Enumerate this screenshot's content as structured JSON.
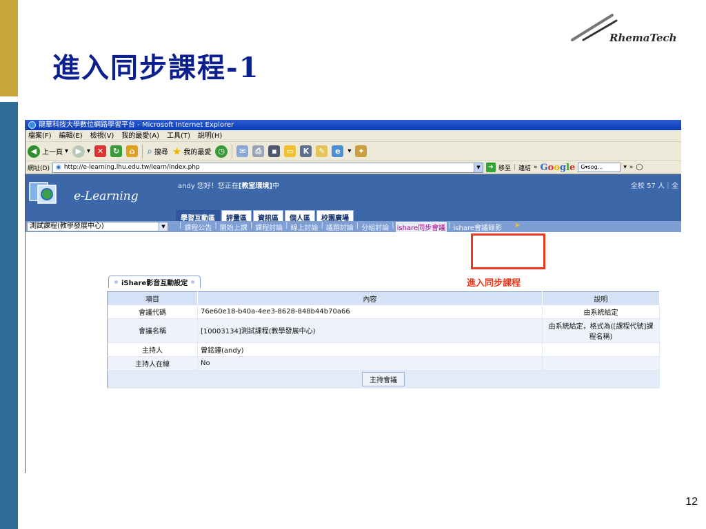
{
  "slide": {
    "title": "進入同步課程-1",
    "logo_text": "RhemaTech",
    "page_number": "12"
  },
  "browser": {
    "window_title": "龍華科技大學數位網路學習平台 - Microsoft Internet Explorer",
    "menu": [
      "檔案(F)",
      "編輯(E)",
      "檢視(V)",
      "我的最愛(A)",
      "工具(T)",
      "說明(H)"
    ],
    "toolbar": {
      "back_label": "上一頁",
      "search_label": "搜尋",
      "favorites_label": "我的最愛"
    },
    "address": {
      "label": "網址(D)",
      "url": "http://e-learning.lhu.edu.tw/learn/index.php",
      "go_label": "移至",
      "links_label": "連結",
      "google": "Google",
      "google_input": "G▾sog..."
    }
  },
  "site": {
    "name": "e-Learning",
    "greeting_user": "andy",
    "greeting_prefix": "您好！您正在",
    "greeting_place": "[教室環境]",
    "greeting_suffix": "中",
    "online_count": "全校 57 人｜全",
    "tabs": [
      "學習互動區",
      "評量區",
      "資訊區",
      "個人區",
      "校園廣場"
    ],
    "course_select": "測試課程(教學發展中心)",
    "nav_links": [
      "課程公告",
      "開始上課",
      "課程討論",
      "線上討論",
      "議題討論",
      "分組討論"
    ],
    "nav_highlight": "ishare同步會議",
    "nav_record": "ishare會議錄影"
  },
  "callout": {
    "label": "進入同步課程"
  },
  "panel": {
    "tab_label": "iShare影音互動設定",
    "headers": [
      "項目",
      "內容",
      "說明"
    ],
    "rows": [
      {
        "item": "會議代碼",
        "content": "76e60e18-b40a-4ee3-8628-848b44b70a66",
        "note": "由系統給定"
      },
      {
        "item": "會議名稱",
        "content": "[10003134]測試課程(教學發展中心)",
        "note": "由系統給定，格式為([課程代號]課程名稱)"
      },
      {
        "item": "主持人",
        "content": "曾銘鐘(andy)",
        "note": ""
      },
      {
        "item": "主持人在線",
        "content": "No",
        "note": ""
      }
    ],
    "host_button": "主持會議"
  }
}
